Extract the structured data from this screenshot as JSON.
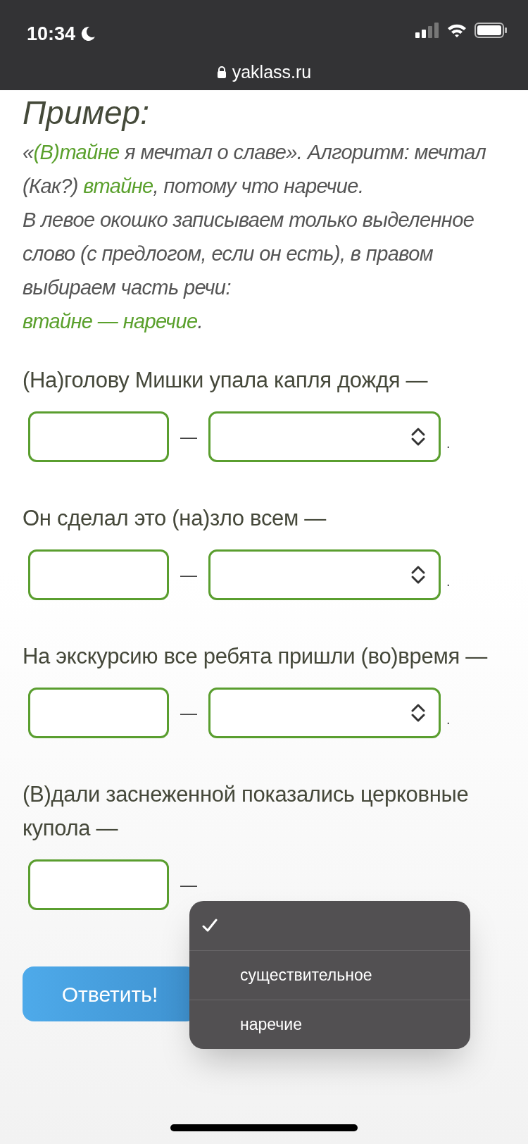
{
  "status_bar": {
    "time": "10:34",
    "url": "yaklass.ru"
  },
  "heading": "Пример:",
  "example": [
    [
      {
        "text": "«",
        "highlight": false
      },
      {
        "text": "(В)тайне",
        "highlight": true
      },
      {
        "text": " я мечтал о славе». Алгоритм: мечтал (Как?) ",
        "highlight": false
      },
      {
        "text": "втайне",
        "highlight": true
      },
      {
        "text": ", потому что наречие.",
        "highlight": false
      }
    ],
    [
      {
        "text": "В левое окошко записываем только выделенное слово (с предлогом, если он есть), в правом выбираем часть речи:",
        "highlight": false
      }
    ],
    [
      {
        "text": "втайне — наречие",
        "highlight": true
      },
      {
        "text": ".",
        "highlight": false
      }
    ]
  ],
  "questions": [
    {
      "text": "(На)голову Мишки упала капля дождя —",
      "separator": "—",
      "end": "."
    },
    {
      "text": "Он сделал это (на)зло всем —",
      "separator": "—",
      "end": "."
    },
    {
      "text": "На экскурсию все ребята пришли (во)время —",
      "separator": "—",
      "end": "."
    },
    {
      "text": "(В)дали заснеженной показались церковные купола —",
      "separator": "—"
    }
  ],
  "dropdown": {
    "options": [
      {
        "selected": true
      },
      {
        "label": "существительное",
        "selected": false
      },
      {
        "label": "наречие",
        "selected": false
      }
    ]
  },
  "submit_button": "Ответить!"
}
